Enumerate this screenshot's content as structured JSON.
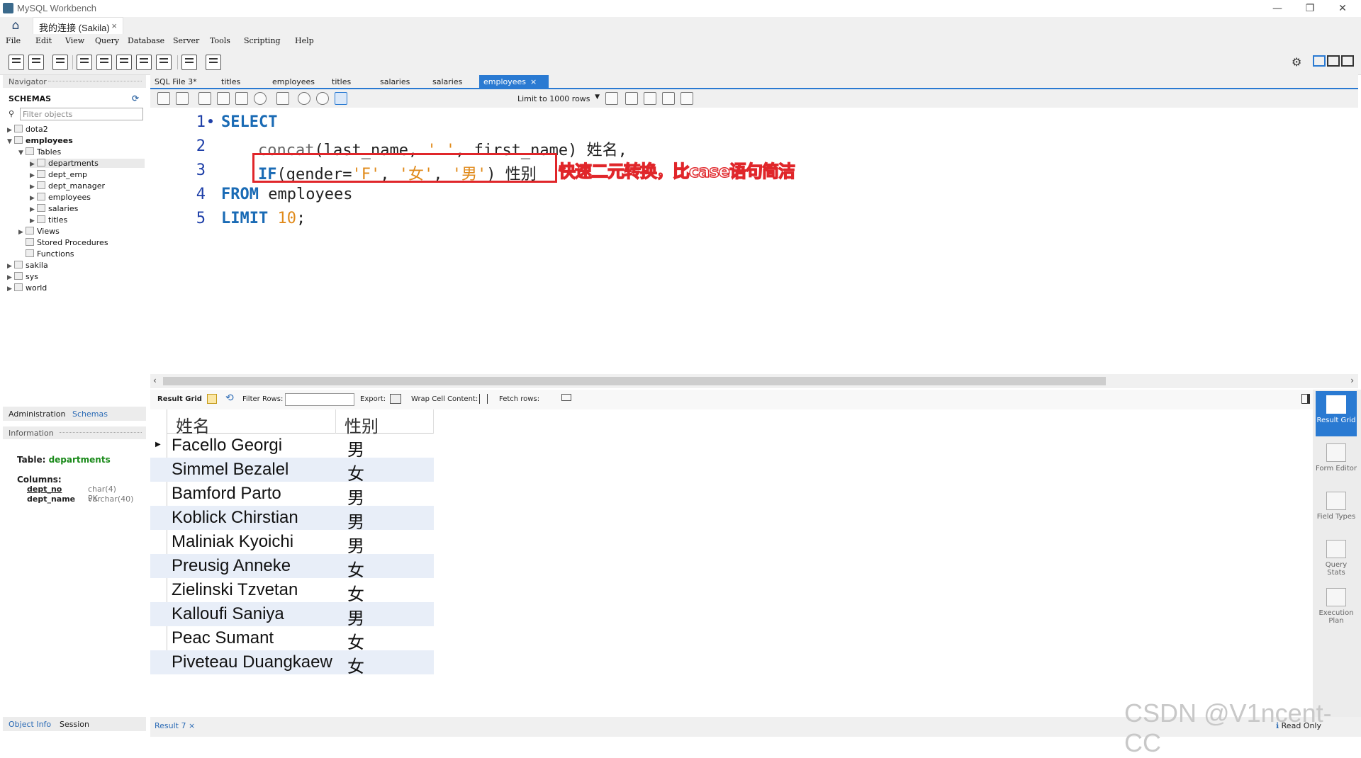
{
  "window": {
    "title": "MySQL Workbench",
    "min": "—",
    "max": "❐",
    "close": "✕"
  },
  "connection_tab": {
    "label": "我的连接 (Sakila)",
    "close": "×"
  },
  "menu": [
    "File",
    "Edit",
    "View",
    "Query",
    "Database",
    "Server",
    "Tools",
    "Scripting",
    "Help"
  ],
  "navigator": {
    "title": "Navigator",
    "schemas_header": "SCHEMAS",
    "filter_placeholder": "Filter objects",
    "tree": {
      "dota2": "dota2",
      "employees": "employees",
      "tables": "Tables",
      "table_items": [
        "departments",
        "dept_emp",
        "dept_manager",
        "employees",
        "salaries",
        "titles"
      ],
      "views": "Views",
      "stored_procedures": "Stored Procedures",
      "functions": "Functions",
      "sakila": "sakila",
      "sys": "sys",
      "world": "world"
    },
    "tabs": {
      "administration": "Administration",
      "schemas": "Schemas"
    },
    "information_title": "Information",
    "info": {
      "table_label": "Table:",
      "table_name": "departments",
      "columns_label": "Columns:",
      "col1_name": "dept_no",
      "col1_type": "char(4) PK",
      "col2_name": "dept_name",
      "col2_type": "varchar(40)"
    },
    "bottom_tabs": {
      "object_info": "Object Info",
      "session": "Session"
    }
  },
  "editor_tabs": [
    "SQL File 3*",
    "titles",
    "employees",
    "titles",
    "salaries",
    "salaries",
    "employees"
  ],
  "active_tab_close": "×",
  "sql_toolbar": {
    "limit": "Limit to 1000 rows"
  },
  "code": {
    "line_numbers": [
      "1",
      "2",
      "3",
      "4",
      "5"
    ],
    "l1_kw": "SELECT",
    "l2_fn": "concat",
    "l2_a": "(last_name, ",
    "l2_str": "' '",
    "l2_b": ", first_name) 姓名,",
    "l3_kw": "IF",
    "l3_a": "(gender=",
    "l3_s1": "'F'",
    "l3_c1": ", ",
    "l3_s2": "'女'",
    "l3_c2": ", ",
    "l3_s3": "'男'",
    "l3_b": ") 性别",
    "l4_kw": "FROM",
    "l4_a": " employees",
    "l5_kw": "LIMIT",
    "l5_num": "10",
    "l5_a": ";"
  },
  "annotation": "快速二元转换，比case语句简洁",
  "result_toolbar": {
    "result_grid": "Result Grid",
    "filter_rows": "Filter Rows:",
    "export": "Export:",
    "wrap": "Wrap Cell Content:",
    "fetch": "Fetch rows:"
  },
  "grid": {
    "columns": [
      "姓名",
      "性别"
    ],
    "rows": [
      [
        "Facello Georgi",
        "男"
      ],
      [
        "Simmel Bezalel",
        "女"
      ],
      [
        "Bamford Parto",
        "男"
      ],
      [
        "Koblick Chirstian",
        "男"
      ],
      [
        "Maliniak Kyoichi",
        "男"
      ],
      [
        "Preusig Anneke",
        "女"
      ],
      [
        "Zielinski Tzvetan",
        "女"
      ],
      [
        "Kalloufi Saniya",
        "男"
      ],
      [
        "Peac Sumant",
        "女"
      ],
      [
        "Piveteau Duangkaew",
        "女"
      ]
    ]
  },
  "side_panel": [
    "Result Grid",
    "Form Editor",
    "Field Types",
    "Query Stats",
    "Execution Plan"
  ],
  "status": {
    "result_tab": "Result 7",
    "read_only": "Read Only"
  },
  "watermark": "CSDN @V1ncent-CC",
  "colors": {
    "accent": "#2a7ad2",
    "annotation": "#e0262a",
    "keyword": "#1a6bb5",
    "string": "#e08a1a"
  }
}
